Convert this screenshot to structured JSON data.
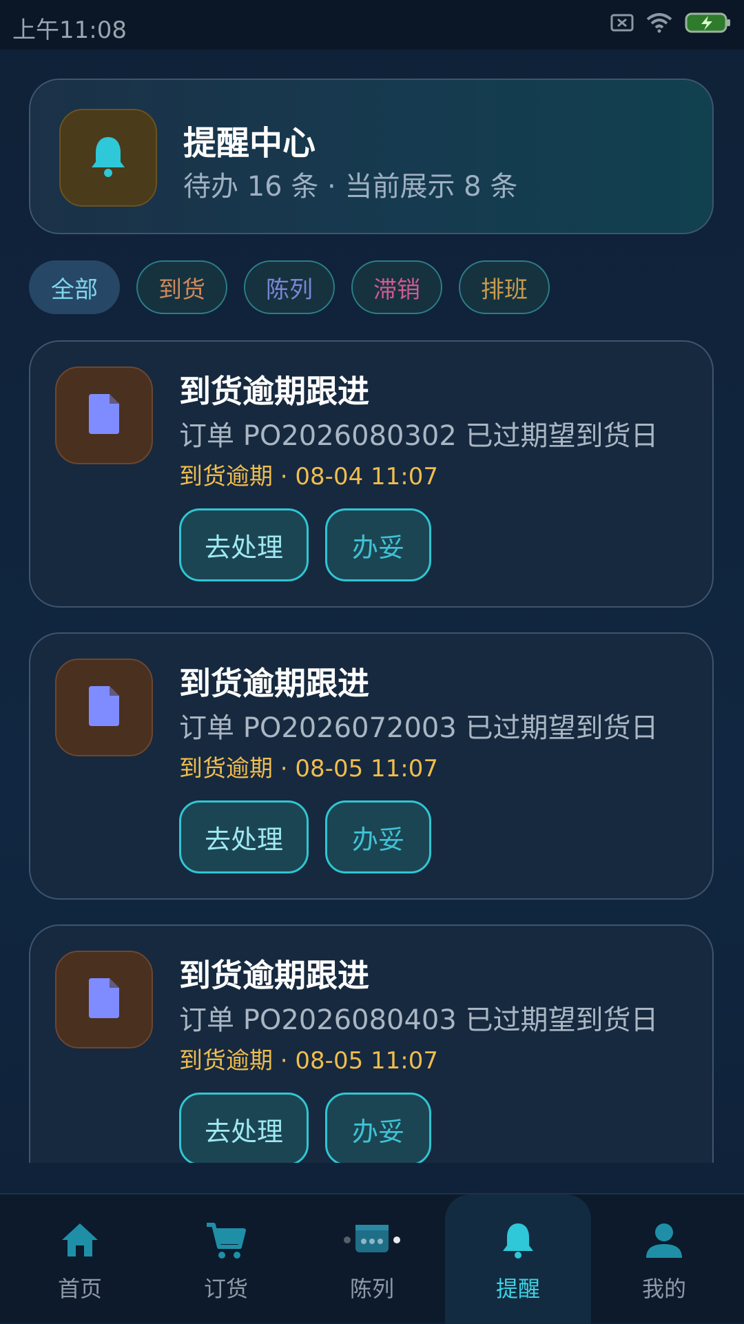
{
  "status_bar": {
    "time": "上午11:08"
  },
  "header": {
    "title": "提醒中心",
    "subtitle": "待办 16 条 · 当前展示 8 条",
    "icon": "bell-icon"
  },
  "filters": [
    {
      "label": "全部",
      "color": "#7fd6ec",
      "active": true
    },
    {
      "label": "到货",
      "color": "#d0895a",
      "active": false
    },
    {
      "label": "陈列",
      "color": "#7b86d6",
      "active": false
    },
    {
      "label": "滞销",
      "color": "#d05a92",
      "active": false
    },
    {
      "label": "排班",
      "color": "#c89c4c",
      "active": false
    }
  ],
  "reminders": [
    {
      "title": "到货逾期跟进",
      "desc": "订单 PO2026080302 已过期望到货日",
      "meta": "到货逾期 · 08-04 11:07",
      "primary_action": "去处理",
      "secondary_action": "办妥",
      "icon": "document-icon"
    },
    {
      "title": "到货逾期跟进",
      "desc": "订单 PO2026072003 已过期望到货日",
      "meta": "到货逾期 · 08-05 11:07",
      "primary_action": "去处理",
      "secondary_action": "办妥",
      "icon": "document-icon"
    },
    {
      "title": "到货逾期跟进",
      "desc": "订单 PO2026080403 已过期望到货日",
      "meta": "到货逾期 · 08-05 11:07",
      "primary_action": "去处理",
      "secondary_action": "办妥",
      "icon": "document-icon"
    }
  ],
  "nav": [
    {
      "label": "首页",
      "icon": "home-icon",
      "active": false
    },
    {
      "label": "订货",
      "icon": "cart-icon",
      "active": false
    },
    {
      "label": "陈列",
      "icon": "display-icon",
      "active": false
    },
    {
      "label": "提醒",
      "icon": "bell-icon",
      "active": true
    },
    {
      "label": "我的",
      "icon": "user-icon",
      "active": false
    }
  ],
  "colors": {
    "accent": "#3dd2e2",
    "warning": "#f1bd4d",
    "doc_icon": "#7f8cff"
  }
}
